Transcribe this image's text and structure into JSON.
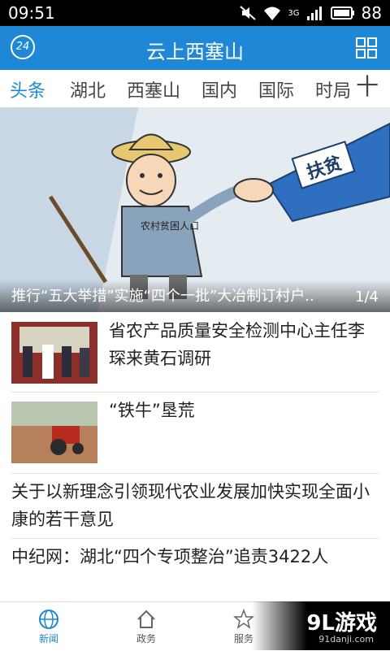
{
  "status": {
    "time": "09:51",
    "battery": "88",
    "network": "3G"
  },
  "appbar": {
    "title": "云上西塞山",
    "weather": "24"
  },
  "tabs": {
    "items": [
      "头条",
      "湖北",
      "西塞山",
      "国内",
      "国际",
      "时局"
    ],
    "add": "十"
  },
  "hero": {
    "caption": "推行“五大举措”实施“四个一批”大冶制订村户..",
    "pager_current": "1",
    "pager_total": "4",
    "sign_text": "扶贫",
    "shirt_text": "农村贫困人口"
  },
  "news": [
    {
      "title": "省农产品质量安全检测中心主任李琛来黄石调研"
    },
    {
      "title": "“铁牛”垦荒"
    },
    {
      "title": "关于以新理念引领现代农业发展加快实现全面小康的若干意见"
    },
    {
      "title": "中纪网：湖北“四个专项整治”追责3422人"
    }
  ],
  "bottomnav": {
    "items": [
      "新闻",
      "政务",
      "服务"
    ]
  },
  "watermark": {
    "logo": "9L游戏",
    "url": "91danji.com"
  },
  "colors": {
    "accent": "#1e88d6"
  }
}
